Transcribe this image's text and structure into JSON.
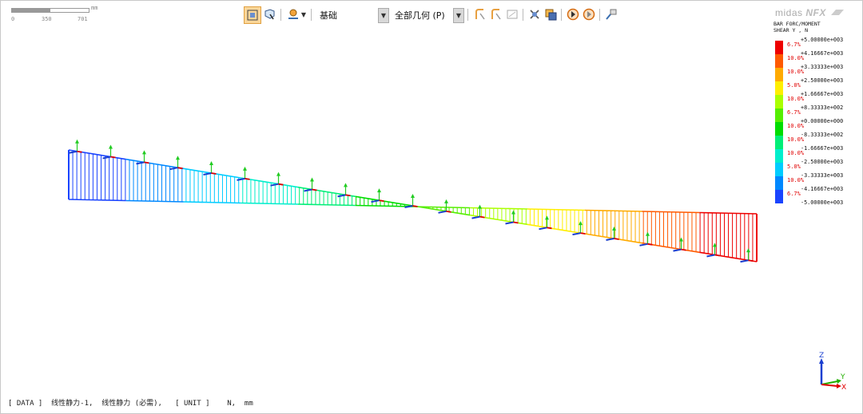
{
  "scale": {
    "unit": "mm",
    "ticks": [
      "0",
      "350",
      "701"
    ]
  },
  "toolbar": {
    "combo1_label": "基础",
    "combo2_label": "全部几何 (P)",
    "icons": [
      "view-fit-icon",
      "cube-select-icon",
      "render-style-icon",
      "dropdown-arrow-icon",
      "select-node-icon",
      "select-element-icon",
      "select-area-icon",
      "deselect-icon",
      "hide-icon",
      "front-view-icon",
      "back-view-icon",
      "camera-icon"
    ]
  },
  "brand": {
    "text": "midas",
    "product": "NFX"
  },
  "legend": {
    "title": "BAR FORC/MOMENT\nSHEAR Y , N",
    "values": [
      "+5.00000e+003",
      "+4.16667e+003",
      "+3.33333e+003",
      "+2.50000e+003",
      "+1.66667e+003",
      "+8.33333e+002",
      "+0.00000e+000",
      "-8.33333e+002",
      "-1.66667e+003",
      "-2.50000e+003",
      "-3.33333e+003",
      "-4.16667e+003",
      "-5.00000e+003"
    ],
    "percents": [
      "6.7%",
      "10.0%",
      "10.0%",
      "5.0%",
      "10.0%",
      "6.7%",
      "10.0%",
      "10.0%",
      "10.0%",
      "5.0%",
      "10.0%",
      "6.7%"
    ],
    "colors": [
      "#ee0000",
      "#ff5a00",
      "#ffaa00",
      "#ffee00",
      "#aaff00",
      "#55ee00",
      "#00dd00",
      "#00ee77",
      "#00eecc",
      "#00ccff",
      "#0088ff",
      "#1a44ff"
    ]
  },
  "axes": {
    "z": "Z",
    "y": "Y",
    "x": "X"
  },
  "status": "[ DATA ]  线性静力-1,  线性静力 (必需),   [ UNIT ]    N,  mm"
}
